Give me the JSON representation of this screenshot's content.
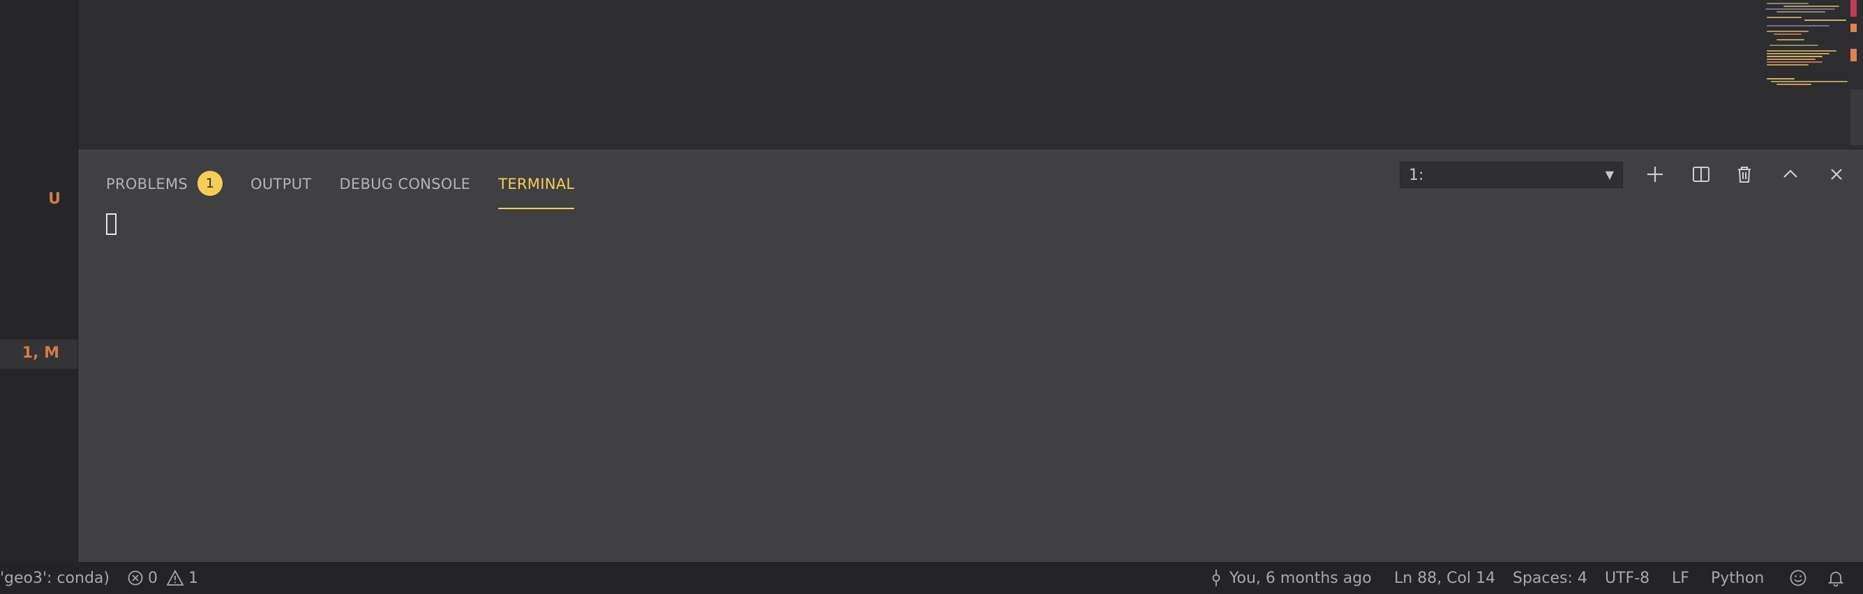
{
  "sidebar": {
    "badges": [
      {
        "label": "U"
      },
      {
        "label": "1, M"
      }
    ]
  },
  "panel": {
    "tabs": [
      {
        "label": "PROBLEMS",
        "badge": "1",
        "active": false
      },
      {
        "label": "OUTPUT",
        "active": false
      },
      {
        "label": "DEBUG CONSOLE",
        "active": false
      },
      {
        "label": "TERMINAL",
        "active": true
      }
    ],
    "terminal_select": {
      "value": "1:"
    },
    "actions": [
      "plus-icon",
      "split-icon",
      "trash-icon",
      "chevron-up-icon",
      "close-icon"
    ]
  },
  "statusbar": {
    "interpreter": "'geo3': conda)",
    "errors": "0",
    "warnings": "1",
    "git_blame": "You, 6 months ago",
    "cursor_position": "Ln 88, Col 14",
    "indentation": "Spaces: 4",
    "encoding": "UTF-8",
    "eol": "LF",
    "language": "Python"
  },
  "colors": {
    "accent": "#f5cf55",
    "badge_text": "#d57b48",
    "panel_bg": "#403f42",
    "editor_bg": "#2d2c2e",
    "statusbar_bg": "#242326"
  }
}
